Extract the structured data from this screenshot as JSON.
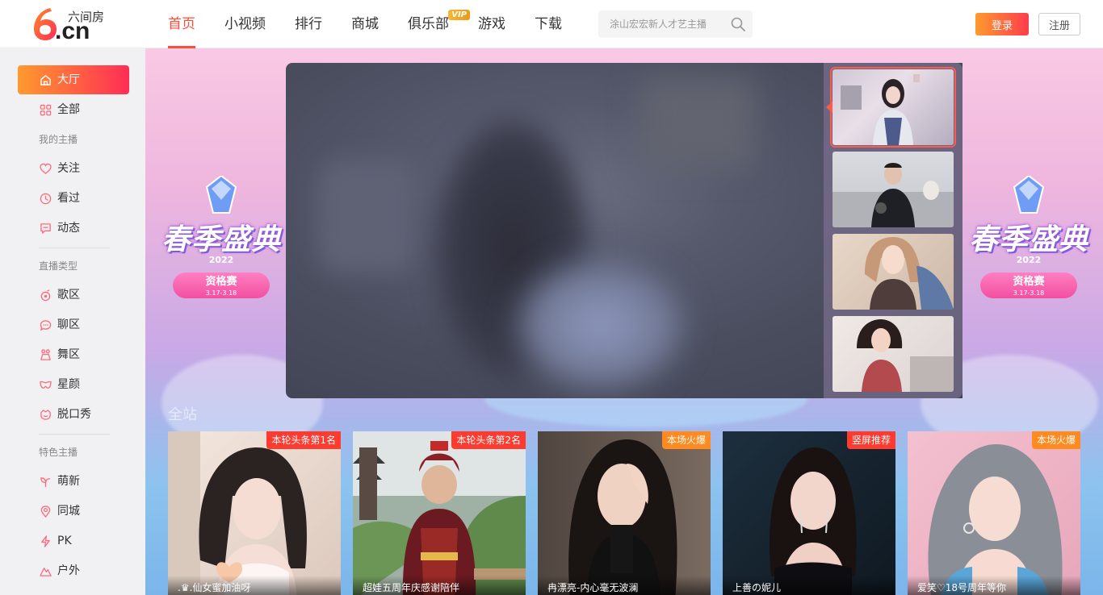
{
  "header": {
    "logo_sub": "六间房",
    "logo_cn": ".cn",
    "nav": [
      {
        "label": "首页",
        "active": true
      },
      {
        "label": "小视频"
      },
      {
        "label": "排行"
      },
      {
        "label": "商城"
      },
      {
        "label": "俱乐部",
        "badge": "VIP"
      },
      {
        "label": "游戏"
      },
      {
        "label": "下载"
      }
    ],
    "search_placeholder": "涂山宏宏新人才艺主播",
    "login_label": "登录",
    "register_label": "注册"
  },
  "sidebar": {
    "top_items": [
      {
        "label": "大厅",
        "icon": "home-icon",
        "active": true
      },
      {
        "label": "全部",
        "icon": "grid-icon"
      }
    ],
    "groups": [
      {
        "title": "我的主播",
        "items": [
          {
            "label": "关注",
            "icon": "heart-icon"
          },
          {
            "label": "看过",
            "icon": "clock-icon"
          },
          {
            "label": "动态",
            "icon": "message-icon"
          }
        ]
      },
      {
        "title": "直播类型",
        "items": [
          {
            "label": "歌区",
            "icon": "music-icon"
          },
          {
            "label": "聊区",
            "icon": "chat-icon"
          },
          {
            "label": "舞区",
            "icon": "dance-icon"
          },
          {
            "label": "星颜",
            "icon": "mask-icon"
          },
          {
            "label": "脱口秀",
            "icon": "smile-icon"
          }
        ]
      },
      {
        "title": "特色主播",
        "items": [
          {
            "label": "萌新",
            "icon": "sprout-icon"
          },
          {
            "label": "同城",
            "icon": "location-icon"
          },
          {
            "label": "PK",
            "icon": "lightning-icon"
          },
          {
            "label": "户外",
            "icon": "mountain-icon"
          }
        ]
      }
    ]
  },
  "banner": {
    "event_title": "春季盛典",
    "event_year": "2022",
    "event_pill": "资格赛",
    "event_dates": "3.17-3.18",
    "section_title": "全站"
  },
  "cards": [
    {
      "tag": "本轮头条第1名",
      "tag_color": "#ff3b30",
      "caption": ".♛.仙女蜜加油呀"
    },
    {
      "tag": "本轮头条第2名",
      "tag_color": "#ff3b30",
      "caption": "超娃五周年庆感谢陪伴"
    },
    {
      "tag": "本场火爆",
      "tag_color": "#ff8a1f",
      "caption": "冉漂亮-内心毫无波澜"
    },
    {
      "tag": "竖屏推荐",
      "tag_color": "#ff3b30",
      "caption": "上善の妮儿"
    },
    {
      "tag": "本场火爆",
      "tag_color": "#ff8a1f",
      "caption": "爱笑♡18号周年等你"
    }
  ],
  "colors": {
    "accent": "#ff4d3a",
    "brand_gradient_start": "#ff9a2e",
    "brand_gradient_end": "#ff2d55"
  }
}
